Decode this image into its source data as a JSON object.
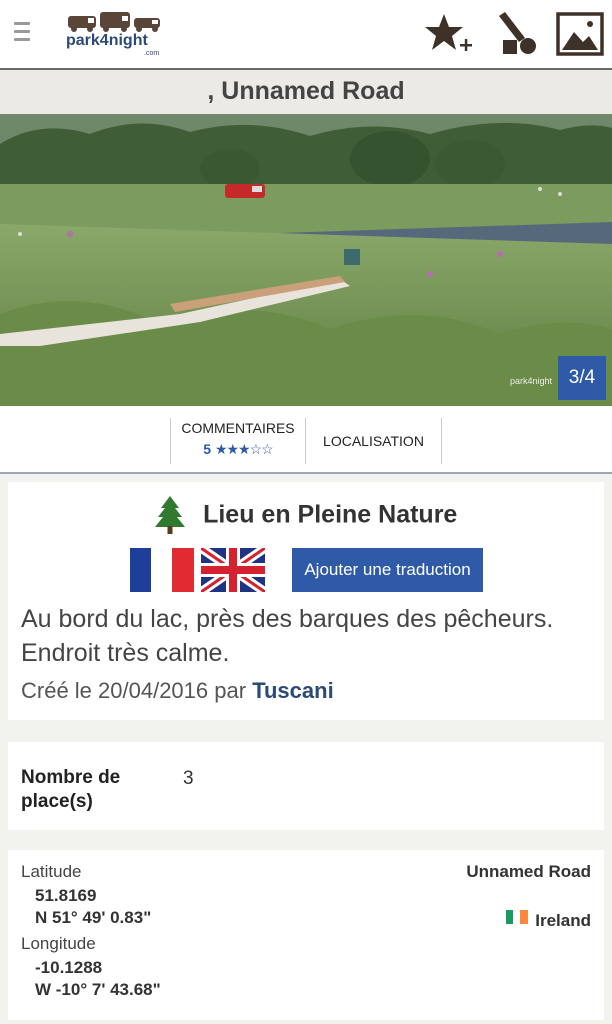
{
  "header": {
    "logo_text": "park4night",
    "logo_suffix": ".com"
  },
  "place": {
    "title": ",  Unnamed Road"
  },
  "photo": {
    "counter": "3/4",
    "credit": "park4night"
  },
  "tabs": {
    "comments_label": "COMMENTAIRES",
    "rating_count": "5",
    "rating_stars": "★★★☆☆",
    "rating_value": 3.5,
    "location_label": "LOCALISATION"
  },
  "description": {
    "type_label": "Lieu en Pleine Nature",
    "translate_button": "Ajouter une traduction",
    "text": "Au bord du lac, près des barques des pêcheurs. Endroit très calme.",
    "created_prefix": "Créé le 20/04/2016 par",
    "author": "Tuscani"
  },
  "details": {
    "places_label": "Nombre de place(s)",
    "places_value": "3"
  },
  "coordinates": {
    "latitude_label": "Latitude",
    "latitude_decimal": "51.8169",
    "latitude_dms": "N 51° 49' 0.83\"",
    "longitude_label": "Longitude",
    "longitude_decimal": "-10.1288",
    "longitude_dms": "W -10° 7' 43.68\"",
    "road": "Unnamed Road",
    "country": "Ireland"
  },
  "colors": {
    "accent": "#2e5aa8",
    "brand": "#2b4a7a"
  },
  "icons": [
    "menu-icon",
    "add-favorite-icon",
    "report-icon",
    "add-photo-icon",
    "tree-icon",
    "flag-fr-icon",
    "flag-gb-icon",
    "flag-ie-icon"
  ]
}
